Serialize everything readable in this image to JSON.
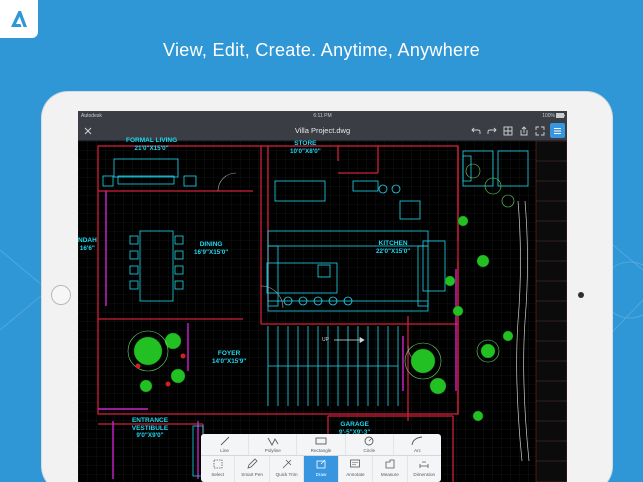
{
  "headline": "View, Edit, Create. Anytime, Anywhere",
  "brand_logo_letter": "A",
  "colors": {
    "background": "#2f97d6",
    "tablet": "#f2f2f2",
    "app_bar": "#3a3e44",
    "cad_cyan": "#20d8f0",
    "cad_red": "#d0203a",
    "cad_magenta": "#d020d0",
    "plant_green": "#22c022",
    "active_blue": "#3796df"
  },
  "status_bar": {
    "carrier": "Autodesk",
    "time": "6:11 PM",
    "battery": "100%"
  },
  "app": {
    "file_title": "Villa Project.dwg",
    "icons": [
      "close-icon",
      "undo-icon",
      "redo-icon",
      "layers-grid-icon",
      "share-icon",
      "fullscreen-icon",
      "menu-icon"
    ]
  },
  "drawing": {
    "rooms": [
      {
        "name": "FORMAL LIVING",
        "dims": "21'0\"X15'0\""
      },
      {
        "name": "STORE",
        "dims": "10'0\"X8'0\""
      },
      {
        "name": "DINING",
        "dims": "16'9\"X15'0\""
      },
      {
        "name": "KITCHEN",
        "dims": "22'0\"X15'0\""
      },
      {
        "name": "NDAH",
        "dims": "16'6\""
      },
      {
        "name": "FOYER",
        "dims": "14'0\"X15'9\""
      },
      {
        "name": "ENTRANCE VESTIBULE",
        "dims": "9'0\"X9'0\""
      },
      {
        "name": "GARAGE",
        "dims": "9'-5\"X9'-3\""
      }
    ],
    "stair_label": "UP"
  },
  "toolbar": {
    "top": [
      {
        "label": "Line",
        "icon": "line-icon"
      },
      {
        "label": "Polyline",
        "icon": "polyline-icon"
      },
      {
        "label": "Rectangle",
        "icon": "rectangle-icon"
      },
      {
        "label": "Circle",
        "icon": "circle-icon"
      },
      {
        "label": "Arc",
        "icon": "arc-icon"
      }
    ],
    "bottom": [
      {
        "label": "Select",
        "icon": "select-icon"
      },
      {
        "label": "Smart Pen",
        "icon": "smart-pen-icon"
      },
      {
        "label": "Quick Trim",
        "icon": "quick-trim-icon"
      },
      {
        "label": "Draw",
        "icon": "draw-icon",
        "selected": true
      },
      {
        "label": "Annotate",
        "icon": "annotate-icon"
      },
      {
        "label": "Measure",
        "icon": "measure-icon"
      },
      {
        "label": "Dimension",
        "icon": "dimension-icon"
      }
    ]
  }
}
